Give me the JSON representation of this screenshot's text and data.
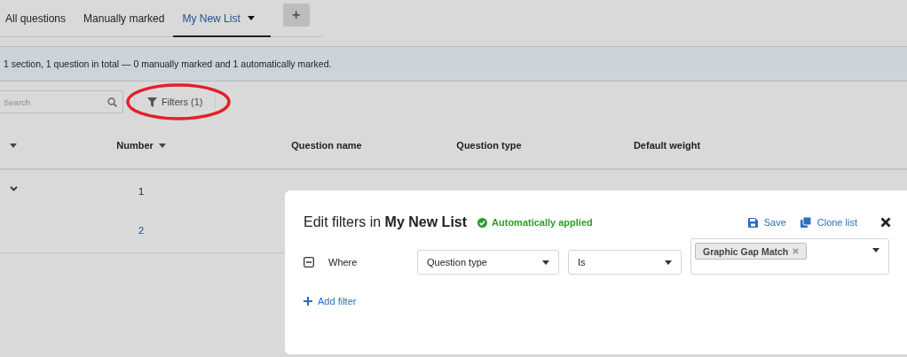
{
  "tabs": [
    {
      "label": "All questions",
      "selected": false,
      "dropdown": false
    },
    {
      "label": "Manually marked",
      "selected": false,
      "dropdown": false
    },
    {
      "label": "My New List",
      "selected": true,
      "dropdown": true
    }
  ],
  "add_tab_button": "+",
  "summary": "1 section, 1 question in total — 0 manually marked and 1 automatically marked.",
  "search": {
    "placeholder": "Search"
  },
  "filters_button": {
    "label": "Filters (1)",
    "highlighted": true
  },
  "table": {
    "columns": [
      {
        "sortable": true
      },
      {
        "label": "Number",
        "sortable": true
      },
      {
        "label": "Question name",
        "sortable": false
      },
      {
        "label": "Question type",
        "sortable": false
      },
      {
        "label": "Default weight",
        "sortable": false
      }
    ],
    "rows": [
      {
        "expanded": true,
        "number": "1",
        "link": false
      },
      {
        "expanded": false,
        "number": "2",
        "link": true
      }
    ]
  },
  "filter_panel": {
    "title_prefix": "Edit filters in ",
    "list_name": "My New List",
    "status": "Automatically applied",
    "actions": [
      {
        "kind": "save",
        "label": "Save"
      },
      {
        "kind": "clone",
        "label": "Clone list"
      }
    ],
    "filters": [
      {
        "label": "Where",
        "field": "Question type",
        "operator": "Is",
        "values": [
          "Graphic Gap Match"
        ]
      }
    ],
    "add_filter": "Add filter"
  }
}
